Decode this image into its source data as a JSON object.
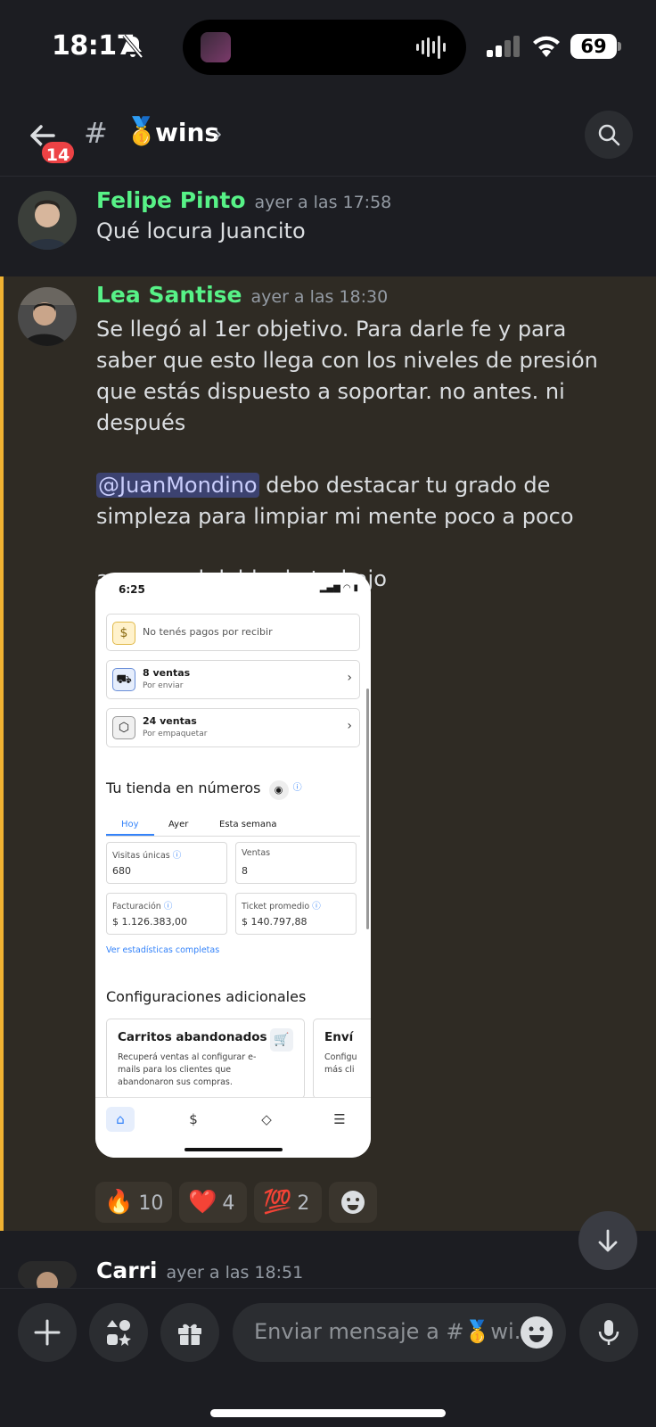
{
  "status_bar": {
    "time": "18:17",
    "battery": "69"
  },
  "header": {
    "unread_badge": "14",
    "hash": "#",
    "channel_emoji": "🥇",
    "channel_name": "wins",
    "chevron": "›"
  },
  "messages": [
    {
      "author": "Felipe Pinto",
      "author_color": "#57f287",
      "timestamp": "ayer a las 17:58",
      "text": "Qué locura Juancito"
    },
    {
      "author": "Lea Santise",
      "author_color": "#57f287",
      "timestamp": "ayer a las 18:30",
      "line1": "Se llegó al 1er objetivo. Para darle fe y para saber que esto llega con los niveles de presión que estás dispuesto a soportar. no antes. ni después",
      "mention": "@JuanMondino",
      "line2": " debo destacar tu grado de simpleza para limpiar mi mente poco a poco",
      "line3": "a poner el doble de trabajo",
      "attachment": {
        "time": "6:25",
        "pending_payments": "No tenés pagos por recibir",
        "shipping_title": "8 ventas",
        "shipping_sub": "Por enviar",
        "packing_title": "24 ventas",
        "packing_sub": "Por empaquetar",
        "section_title": "Tu tienda en números",
        "tabs": [
          "Hoy",
          "Ayer",
          "Esta semana"
        ],
        "stats": [
          {
            "label": "Visitas únicas",
            "value": "680"
          },
          {
            "label": "Ventas",
            "value": "8"
          },
          {
            "label": "Facturación",
            "value": "$ 1.126.383,00"
          },
          {
            "label": "Ticket promedio",
            "value": "$ 140.797,88"
          }
        ],
        "stats_link": "Ver estadísticas completas",
        "config_title": "Configuraciones adicionales",
        "config_card1_title": "Carritos abandonados",
        "config_card1_desc": "Recuperá ventas al configurar e-mails para los clientes que abandonaron sus compras.",
        "config_card2_title": "Enví",
        "config_card2_desc1": "Configu",
        "config_card2_desc2": "más cli"
      },
      "reactions": [
        {
          "emoji": "🔥",
          "count": "10"
        },
        {
          "emoji": "❤️",
          "count": "4"
        },
        {
          "emoji": "💯",
          "count": "2"
        }
      ]
    },
    {
      "author": "Carri",
      "author_color": "#ffffff",
      "timestamp": "ayer a las 18:51"
    }
  ],
  "composer": {
    "placeholder": "Enviar mensaje a #🥇wi.."
  },
  "colors": {
    "background": "#1c1d22",
    "highlight": "#f0b232",
    "green_name": "#57f287",
    "mention_bg": "#3c4270"
  }
}
